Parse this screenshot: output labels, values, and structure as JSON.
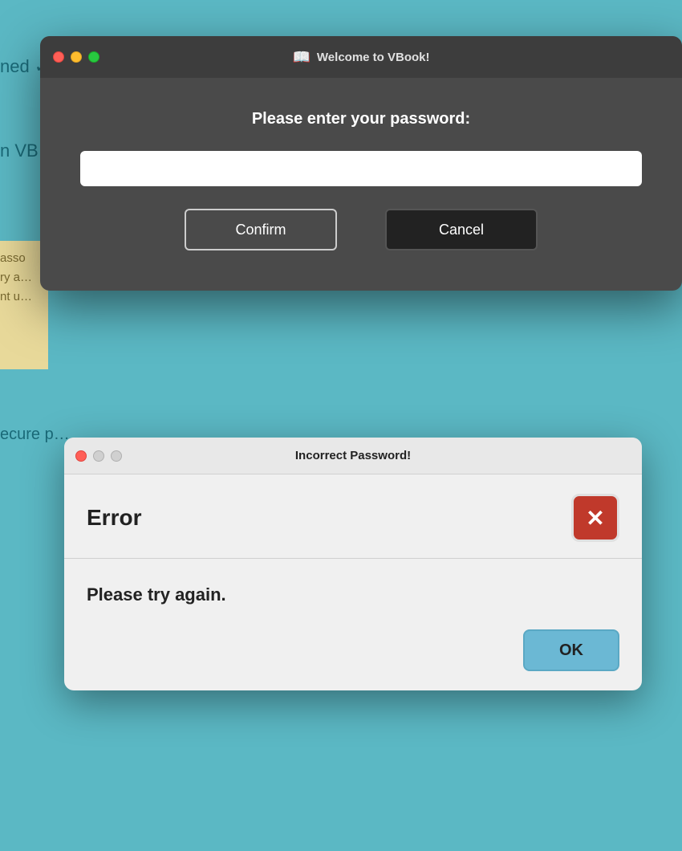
{
  "background": {
    "topText": "ned ✓",
    "midText": "n VB…",
    "yellowTexts": [
      "asso",
      "ry a…",
      "nt u…"
    ],
    "bottomText": "ecure p…"
  },
  "passwordDialog": {
    "titlebarTitle": "Welcome to VBook!",
    "vbookIcon": "📖",
    "trafficLights": [
      "close",
      "minimize",
      "maximize"
    ],
    "prompt": "Please enter your password:",
    "passwordPlaceholder": "",
    "confirmLabel": "Confirm",
    "cancelLabel": "Cancel"
  },
  "errorDialog": {
    "titlebarTitle": "Incorrect Password!",
    "trafficLights": [
      "close",
      "minimize",
      "maximize"
    ],
    "errorHeading": "Error",
    "closeIconLabel": "✕",
    "message": "Please try again.",
    "okLabel": "OK"
  }
}
